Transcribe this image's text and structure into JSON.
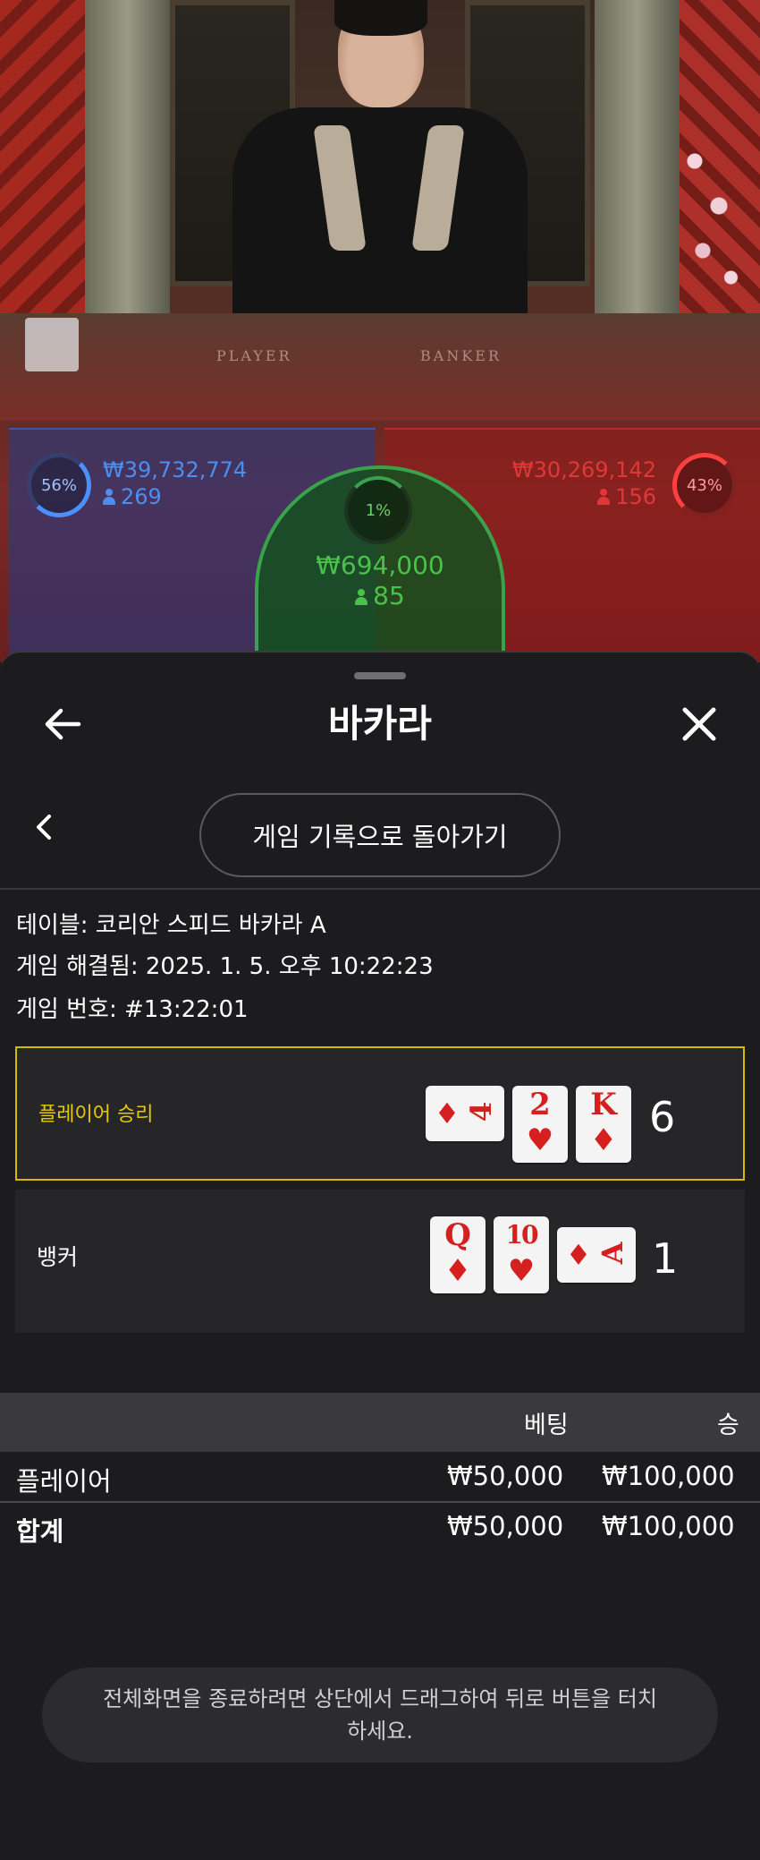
{
  "video": {
    "table_player_label": "PLAYER",
    "table_banker_label": "BANKER",
    "player": {
      "percent": "56%",
      "amount": "₩39,732,774",
      "count": "269"
    },
    "banker": {
      "percent": "43%",
      "amount": "₩30,269,142",
      "count": "156"
    },
    "tie": {
      "percent": "1%",
      "amount": "₩694,000",
      "count": "85"
    },
    "colors": {
      "player": "#4a8ff0",
      "banker": "#e03838",
      "tie": "#4ac24a"
    }
  },
  "header": {
    "title": "바카라",
    "back_icon": "arrow-left-icon",
    "close_icon": "close-icon"
  },
  "nav": {
    "back_icon": "chevron-left-icon",
    "history_button_label": "게임 기록으로 돌아가기"
  },
  "details": {
    "table": "테이블: 코리안 스피드 바카라 A",
    "resolved": "게임 해결됨: 2025. 1. 5. 오후 10:22:23",
    "game_number": "게임 번호: #13:22:01"
  },
  "hands": {
    "player": {
      "label": "플레이어 승리",
      "score": "6",
      "cards": [
        {
          "rank": "4",
          "suit": "♦"
        },
        {
          "rank": "2",
          "suit": "♥"
        },
        {
          "rank": "K",
          "suit": "♦"
        }
      ]
    },
    "banker": {
      "label": "뱅커",
      "score": "1",
      "cards": [
        {
          "rank": "Q",
          "suit": "♦"
        },
        {
          "rank": "10",
          "suit": "♥"
        },
        {
          "rank": "A",
          "suit": "♦"
        }
      ]
    },
    "highlight_color": "#d8b800"
  },
  "bets": {
    "columns": {
      "bet": "베팅",
      "win": "승"
    },
    "rows": [
      {
        "name": "플레이어",
        "bet": "₩50,000",
        "win": "₩100,000"
      }
    ],
    "total": {
      "name": "합계",
      "bet": "₩50,000",
      "win": "₩100,000"
    }
  },
  "toast": {
    "message": "전체화면을 종료하려면 상단에서 드래그하여 뒤로 버튼을 터치하세요."
  }
}
